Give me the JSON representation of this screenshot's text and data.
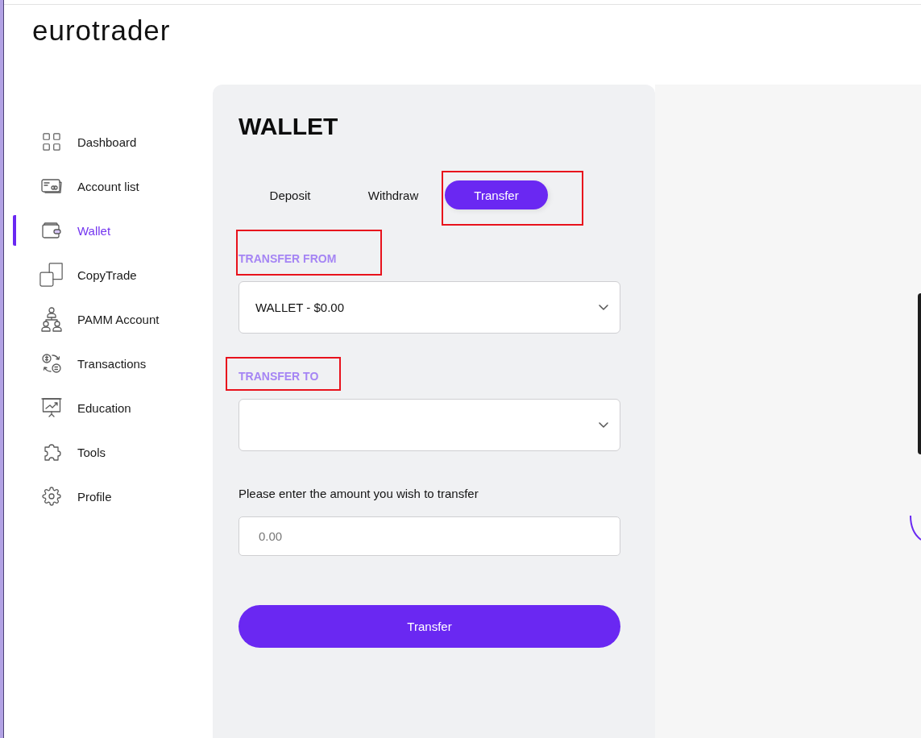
{
  "logo": {
    "text": "eurotrader"
  },
  "sidebar": {
    "items": [
      {
        "label": "Dashboard",
        "selected": false
      },
      {
        "label": "Account list",
        "selected": false
      },
      {
        "label": "Wallet",
        "selected": true
      },
      {
        "label": "CopyTrade",
        "selected": false
      },
      {
        "label": "PAMM Account",
        "selected": false
      },
      {
        "label": "Transactions",
        "selected": false
      },
      {
        "label": "Education",
        "selected": false
      },
      {
        "label": "Tools",
        "selected": false
      },
      {
        "label": "Profile",
        "selected": false
      }
    ]
  },
  "wallet": {
    "title": "WALLET",
    "tabs": [
      {
        "label": "Deposit",
        "selected": false,
        "highlighted": false
      },
      {
        "label": "Withdraw",
        "selected": false,
        "highlighted": false
      },
      {
        "label": "Transfer",
        "selected": true,
        "highlighted": true
      }
    ],
    "fields": [
      {
        "kind": "select",
        "label": "TRANSFER FROM",
        "value": "WALLET - $0.00",
        "highlighted": true
      },
      {
        "kind": "select",
        "label": "TRANSFER TO",
        "highlighted": true
      },
      {
        "kind": "input",
        "label": "Please enter the amount you wish to transfer",
        "placeholder": "0.00",
        "highlighted": false
      }
    ],
    "submit": {
      "label": "Transfer"
    }
  }
}
